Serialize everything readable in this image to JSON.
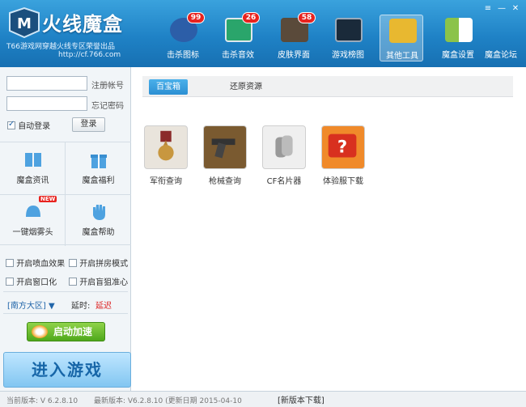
{
  "app": {
    "title": "火线魔盒",
    "subtitle": "T66游戏网穿越火线专区荣誉出品",
    "url": "http://cf.766.com"
  },
  "window_controls": [
    "≡",
    "—",
    "✕"
  ],
  "toolbar": [
    {
      "label": "击杀图标",
      "badge": "99",
      "icon": "kill-icon-shield",
      "color": "#2c5ea8"
    },
    {
      "label": "击杀音效",
      "badge": "26",
      "icon": "sound-monitor-icon",
      "color": "#2aa56b"
    },
    {
      "label": "皮肤界面",
      "badge": "58",
      "icon": "skin-icon",
      "color": "#5a4a3a"
    },
    {
      "label": "游戏榜图",
      "badge": "",
      "icon": "map-icon",
      "color": "#1a2a3a"
    },
    {
      "label": "其他工具",
      "badge": "",
      "icon": "tools-icon",
      "color": "#e8b830"
    },
    {
      "label": "魔盒设置",
      "badge": "",
      "icon": "settings-grid-icon",
      "color": "#8bc34a"
    },
    {
      "label": "魔盒论坛",
      "badge": "",
      "icon": "forum-icon",
      "color": ""
    }
  ],
  "login": {
    "register_label": "注册帐号",
    "forgot_label": "忘记密码",
    "auto_login_label": "自动登录",
    "login_button": "登录"
  },
  "quick": [
    {
      "label": "魔盒资讯",
      "icon": "book-icon"
    },
    {
      "label": "魔盒福利",
      "icon": "gift-icon"
    },
    {
      "label": "一键烟雾头",
      "icon": "helmet-icon",
      "badge": "NEW"
    },
    {
      "label": "魔盒帮助",
      "icon": "hand-icon"
    }
  ],
  "options": [
    "开启喷血效果",
    "开启拼房模式",
    "开启窗口化",
    "开启盲狙准心"
  ],
  "region": {
    "label": "[南方大区]",
    "latency_label": "延时:",
    "latency_value": "延迟"
  },
  "accelerate_button": "启动加速",
  "enter_game_button": "进入游戏",
  "tabs": [
    {
      "label": "百宝箱",
      "active": true
    },
    {
      "label": "还原资源",
      "active": false
    }
  ],
  "tools": [
    {
      "label": "军衔查询",
      "icon": "medal-icon",
      "bg": "#e9e4dc"
    },
    {
      "label": "枪械查询",
      "icon": "revolver-icon",
      "bg": "#7a5a30"
    },
    {
      "label": "CF名片器",
      "icon": "dogtag-icon",
      "bg": "#efefef"
    },
    {
      "label": "体验服下载",
      "icon": "question-icon",
      "bg": "#f08a2a"
    }
  ],
  "status": {
    "current_version": "当前版本: V 6.2.8.10",
    "latest_version": "最新版本: V6.2.8.10 (更新日期 2015-04-10",
    "download_label": "[新版本下载]"
  }
}
